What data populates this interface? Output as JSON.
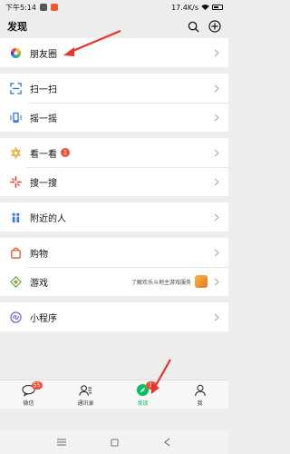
{
  "status_bar": {
    "time": "下午5:14",
    "network_speed": "17.4K/s"
  },
  "header": {
    "title": "发现"
  },
  "groups": [
    [
      {
        "id": "moments",
        "label": "朋友圈"
      }
    ],
    [
      {
        "id": "scan",
        "label": "扫一扫"
      },
      {
        "id": "shake",
        "label": "摇一摇"
      }
    ],
    [
      {
        "id": "top_stories",
        "label": "看一看",
        "badge": "1"
      },
      {
        "id": "search",
        "label": "搜一搜"
      }
    ],
    [
      {
        "id": "nearby",
        "label": "附近的人"
      }
    ],
    [
      {
        "id": "shopping",
        "label": "购物"
      },
      {
        "id": "games",
        "label": "游戏",
        "promo": "了解欢乐斗地主游戏服务"
      }
    ],
    [
      {
        "id": "mini_programs",
        "label": "小程序"
      }
    ]
  ],
  "tabbar": {
    "tabs": [
      {
        "id": "chats",
        "label": "微信",
        "badge": "55"
      },
      {
        "id": "contacts",
        "label": "通讯录"
      },
      {
        "id": "discover",
        "label": "发现",
        "badge": "1",
        "active": true
      },
      {
        "id": "me",
        "label": "我"
      }
    ]
  },
  "colors": {
    "accent": "#07c160",
    "badge": "#f24f3d",
    "annotation_arrow": "#e8332a"
  }
}
